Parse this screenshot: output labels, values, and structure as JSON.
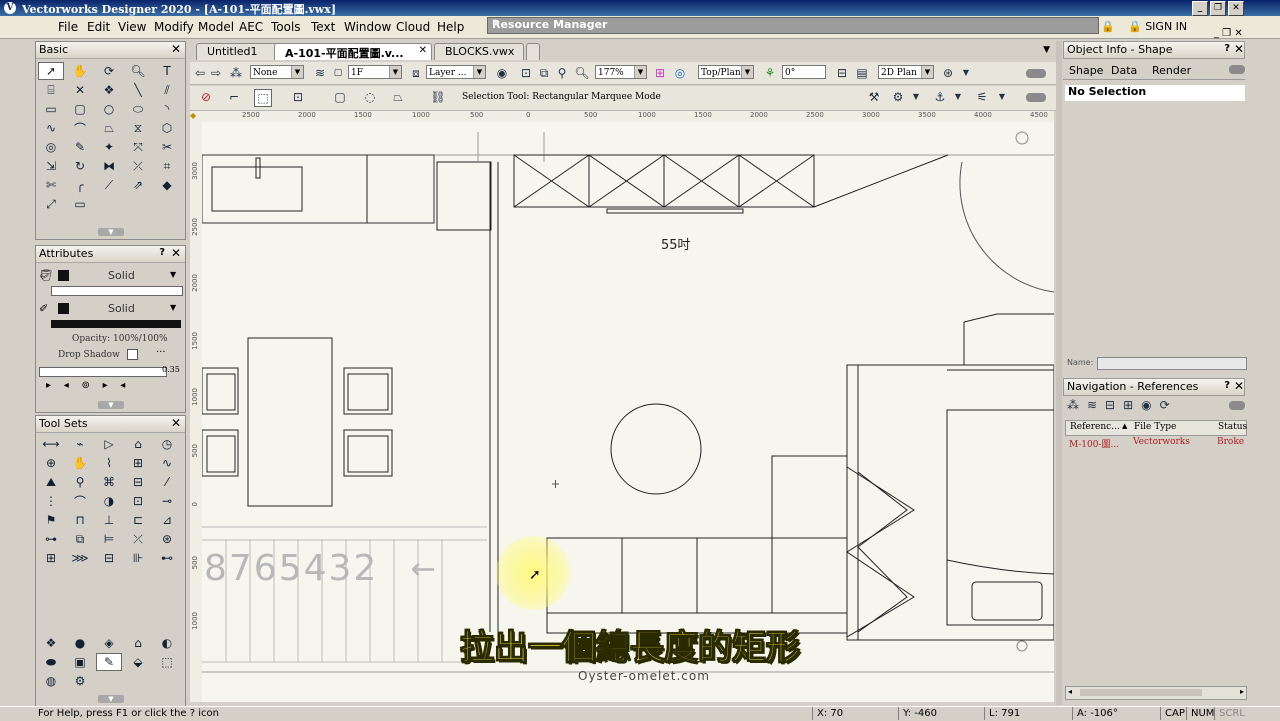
{
  "window": {
    "title": "Vectorworks Designer 2020 - [A-101-平面配置圖.vwx]"
  },
  "menu": [
    "File",
    "Edit",
    "View",
    "Modify",
    "Model",
    "AEC",
    "Tools",
    "Text",
    "Window",
    "Cloud",
    "Help"
  ],
  "resource_manager": {
    "title": "Resource Manager"
  },
  "sign_in": "SIGN IN",
  "palettes": {
    "basic": {
      "title": "Basic"
    },
    "attributes": {
      "title": "Attributes",
      "fill_style": "Solid",
      "pen_style": "Solid",
      "opacity": "Opacity: 100%/100%",
      "drop_shadow": "Drop Shadow",
      "line_thickness": "0.35"
    },
    "tool_sets": {
      "title": "Tool Sets"
    }
  },
  "doc_tabs": [
    "Untitled1",
    "A-101-平面配置圖.v...",
    "BLOCKS.vwx"
  ],
  "view_bar": {
    "class": "None",
    "layer": "1F",
    "layer_option": "Layer ...",
    "zoom": "177%",
    "view": "Top/Plan",
    "angle": "0°",
    "render": "2D Plan"
  },
  "mode_bar": {
    "tool_hint": "Selection Tool: Rectangular Marquee Mode"
  },
  "ruler_labels": [
    "2500",
    "2000",
    "1500",
    "1000",
    "500",
    "0",
    "500",
    "1000",
    "1500",
    "2000",
    "2500",
    "3000",
    "3500",
    "4000",
    "4500"
  ],
  "vruler_labels": [
    "3000",
    "2500",
    "2000",
    "1500",
    "1000",
    "500",
    "0",
    "500",
    "1000"
  ],
  "drawing": {
    "tv_label": "55吋",
    "stair_numbers": "8765432",
    "stair_arrow": "↑"
  },
  "object_info": {
    "title": "Object Info - Shape",
    "tabs": [
      "Shape",
      "Data",
      "Render"
    ],
    "selection": "No Selection",
    "name_label": "Name:"
  },
  "navigation": {
    "title": "Navigation - References",
    "columns": [
      "Referenc...",
      "File Type",
      "Status"
    ],
    "rows": [
      {
        "reference": "M-100-圖...",
        "file_type": "Vectorworks",
        "status": "Broke"
      }
    ]
  },
  "status_bar": {
    "help": "For Help, press F1 or click the ? icon",
    "x": "X: 70",
    "y": "Y: -460",
    "l": "L: 791",
    "a": "A: -106°",
    "caps": "CAP",
    "num": "NUM",
    "scrl": "SCRL"
  },
  "subtitle": "拉出一個總長度的矩形",
  "watermark": "Oyster-omelet.com",
  "colors": {
    "title_bar": "#0a246a",
    "subtitle": "#f7e23a",
    "ref_row": "#b02020"
  }
}
